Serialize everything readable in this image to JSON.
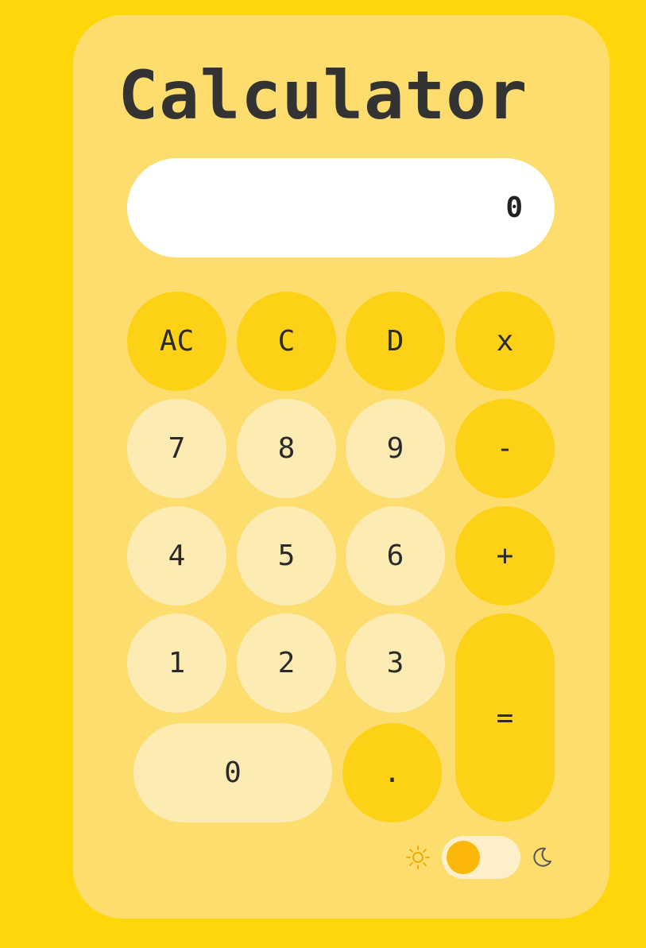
{
  "title": "Calculator",
  "display": {
    "value": "0"
  },
  "buttons": {
    "ac": "AC",
    "c": "C",
    "d": "D",
    "multiply": "x",
    "seven": "7",
    "eight": "8",
    "nine": "9",
    "minus": "-",
    "four": "4",
    "five": "5",
    "six": "6",
    "plus": "+",
    "one": "1",
    "two": "2",
    "three": "3",
    "equals": "=",
    "zero": "0",
    "decimal": "."
  },
  "theme": {
    "light_icon": "sun-icon",
    "dark_icon": "moon-icon",
    "mode": "light"
  },
  "colors": {
    "background": "#FFD60A",
    "card": "#FCDD6E",
    "operator_button": "#FDD116",
    "number_button": "#FCEBB3",
    "toggle_knob": "#FCB80A",
    "text": "#333333"
  }
}
